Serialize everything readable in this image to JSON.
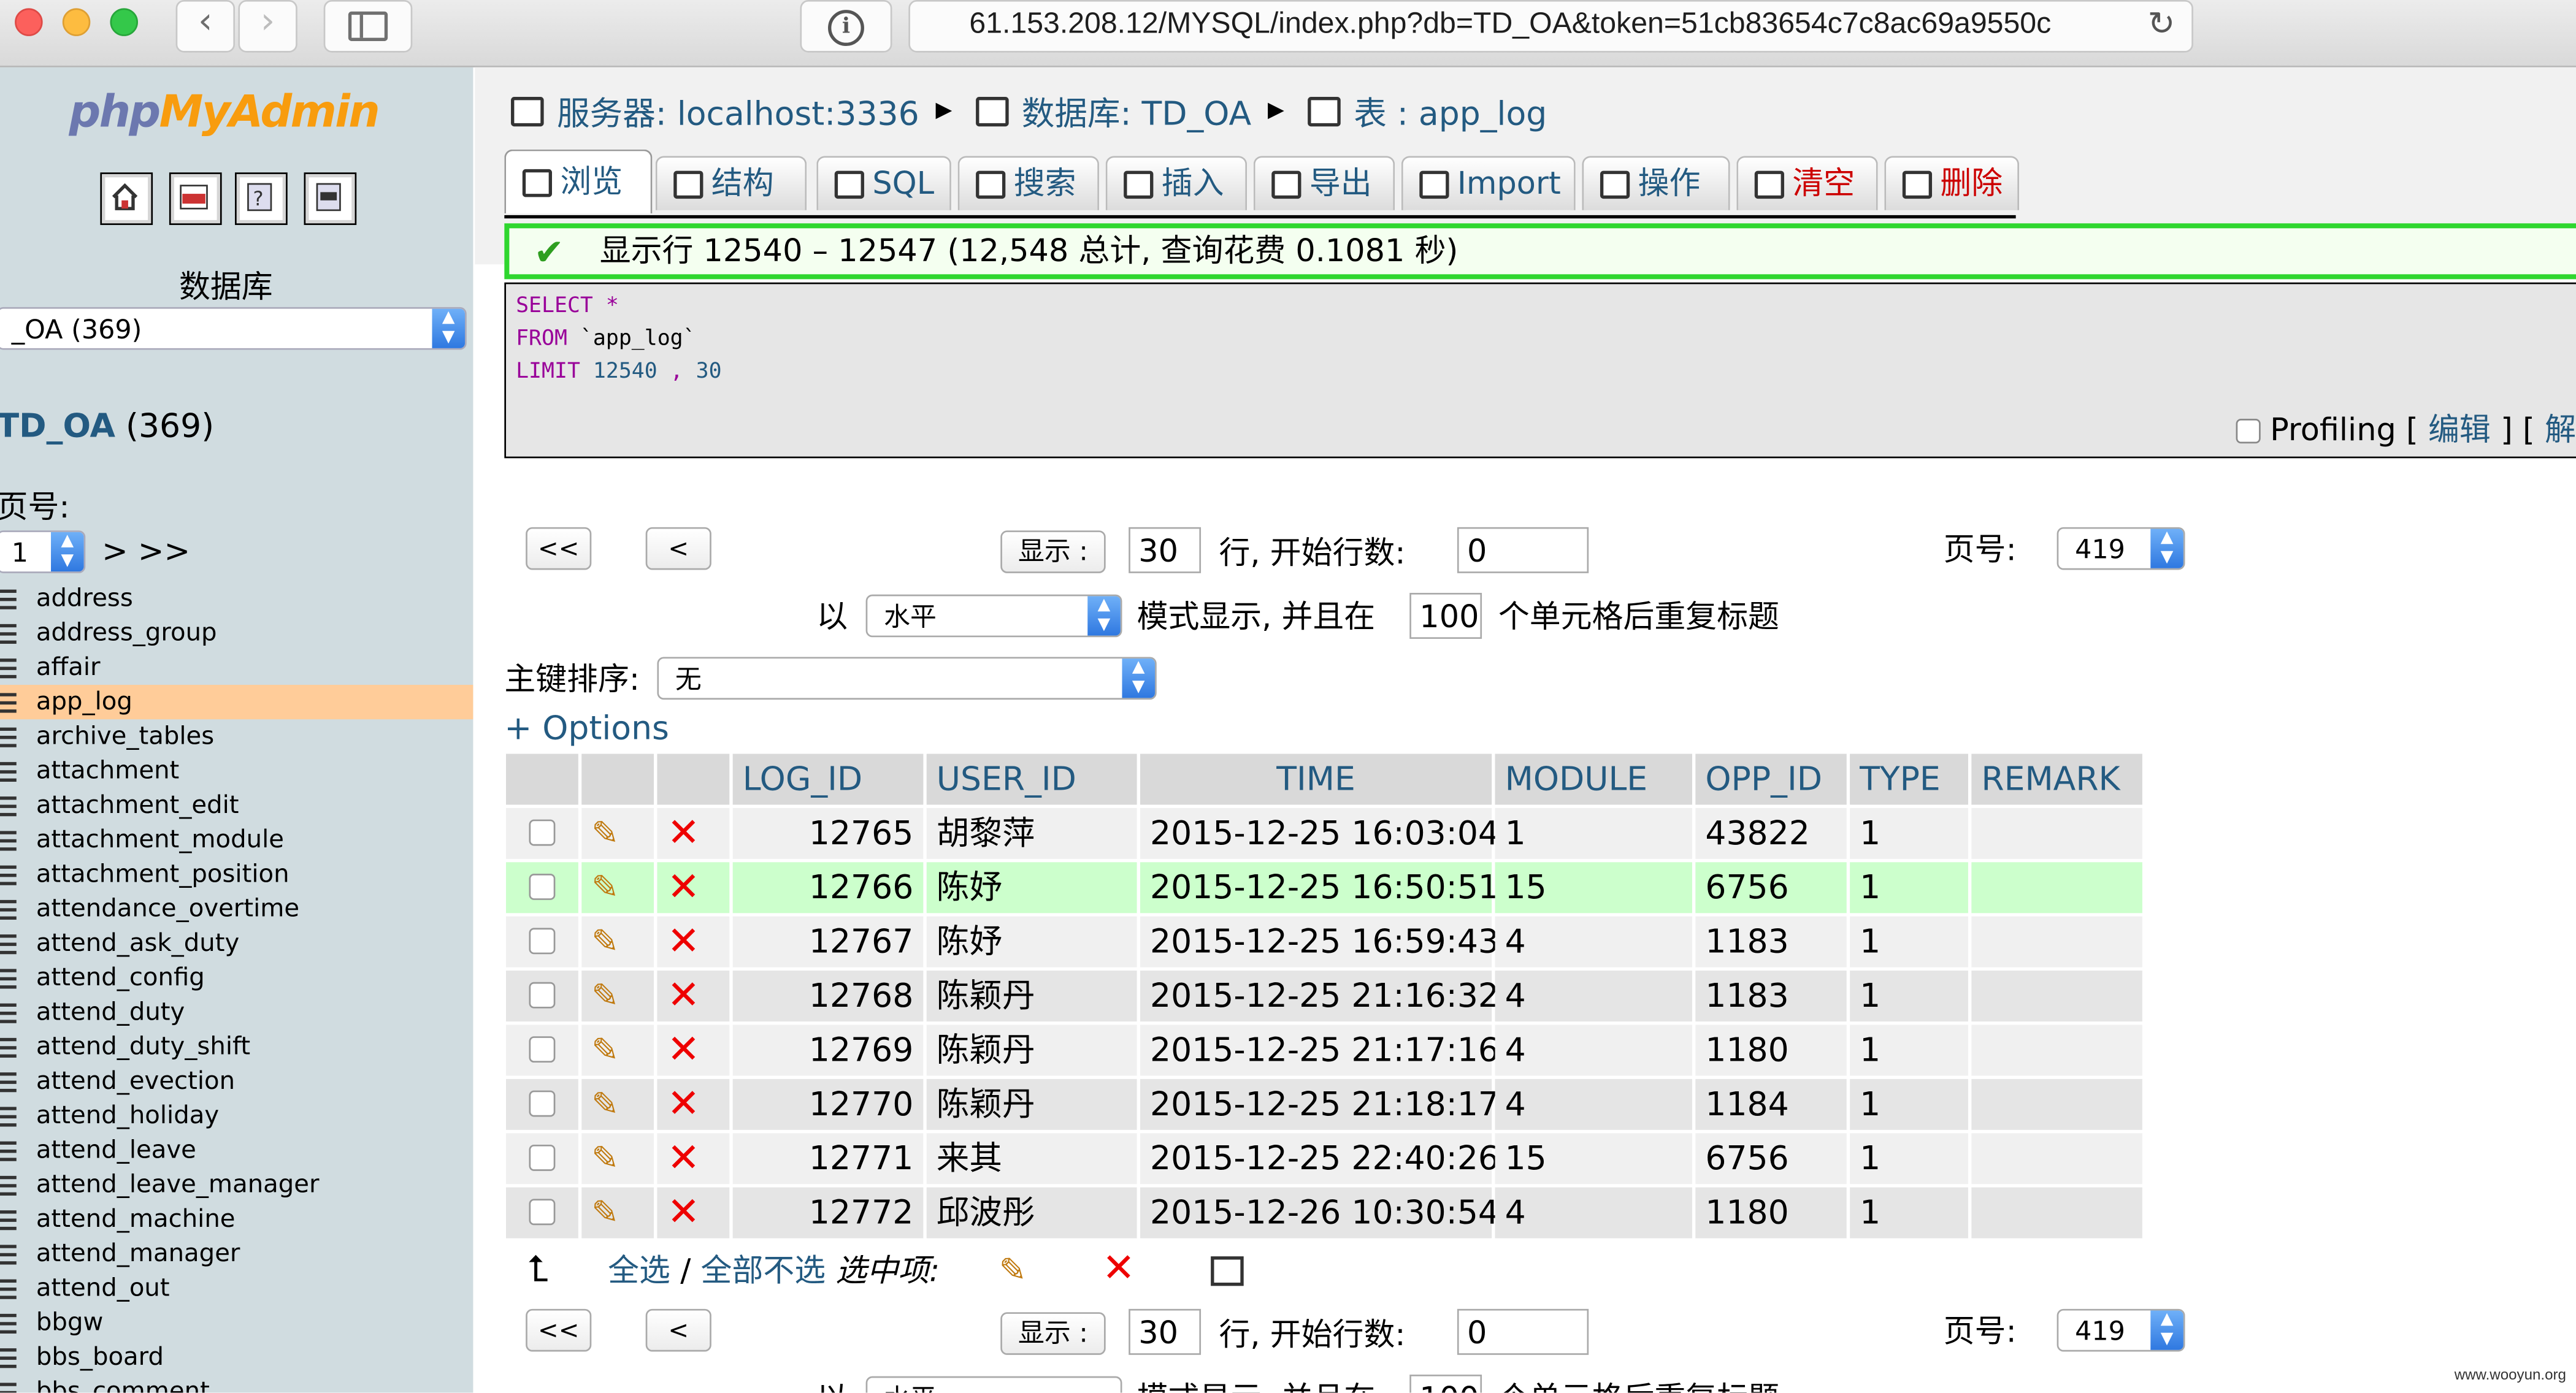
{
  "browser": {
    "url": "61.153.208.12/MYSQL/index.php?db=TD_OA&token=51cb83654c7c8ac69a9550c"
  },
  "left": {
    "logo_a": "php",
    "logo_b": "MyAdmin",
    "db_label": "数据库",
    "db_select": "_OA (369)",
    "db_title": "TD_OA",
    "db_count": "(369)",
    "page_label": "页号:",
    "page_value": "1",
    "page_next": "> >>",
    "tables": [
      "address",
      "address_group",
      "affair",
      "app_log",
      "archive_tables",
      "attachment",
      "attachment_edit",
      "attachment_module",
      "attachment_position",
      "attendance_overtime",
      "attend_ask_duty",
      "attend_config",
      "attend_duty",
      "attend_duty_shift",
      "attend_evection",
      "attend_holiday",
      "attend_leave",
      "attend_leave_manager",
      "attend_machine",
      "attend_manager",
      "attend_out",
      "bbgw",
      "bbs_board",
      "bbs_comment"
    ],
    "active_table": "app_log"
  },
  "breadcrumb": {
    "server": "服务器: localhost:3336",
    "database": "数据库: TD_OA",
    "table": "表 : app_log"
  },
  "tabs": [
    "浏览",
    "结构",
    "SQL",
    "搜索",
    "插入",
    "导出",
    "Import",
    "操作",
    "清空",
    "删除"
  ],
  "message": "显示行 12540 – 12547 (12,548 总计, 查询花费 0.1081 秒)",
  "sql": {
    "select": "SELECT",
    "star": "*",
    "from": "FROM",
    "table": "`app_log`",
    "limit": "LIMIT",
    "offset": "12540",
    "sep": ",",
    "count": "30"
  },
  "profiling": {
    "label": "Profiling",
    "edit": "编辑",
    "explain": "解"
  },
  "nav": {
    "first": "<<",
    "prev": "<",
    "show_label": "显示 :",
    "rows": "30",
    "start_label": "行, 开始行数:",
    "start": "0",
    "page_label": "页号:",
    "page": "419",
    "mode_prefix": "以",
    "mode": "水平",
    "mode_suffix": "模式显示, 并且在",
    "repeat": "100",
    "repeat_suffix": "个单元格后重复标题",
    "sort_label": "主键排序:",
    "sort_value": "无",
    "options": "+ Options"
  },
  "table": {
    "headers": [
      "LOG_ID",
      "USER_ID",
      "TIME",
      "MODULE",
      "OPP_ID",
      "TYPE",
      "REMARK"
    ],
    "rows": [
      [
        "12765",
        "胡黎萍",
        "2015-12-25 16:03:04",
        "1",
        "43822",
        "1",
        ""
      ],
      [
        "12766",
        "陈妤",
        "2015-12-25 16:50:51",
        "15",
        "6756",
        "1",
        ""
      ],
      [
        "12767",
        "陈妤",
        "2015-12-25 16:59:43",
        "4",
        "1183",
        "1",
        ""
      ],
      [
        "12768",
        "陈颖丹",
        "2015-12-25 21:16:32",
        "4",
        "1183",
        "1",
        ""
      ],
      [
        "12769",
        "陈颖丹",
        "2015-12-25 21:17:16",
        "4",
        "1180",
        "1",
        ""
      ],
      [
        "12770",
        "陈颖丹",
        "2015-12-25 21:18:17",
        "4",
        "1184",
        "1",
        ""
      ],
      [
        "12771",
        "来其",
        "2015-12-25 22:40:26",
        "15",
        "6756",
        "1",
        ""
      ],
      [
        "12772",
        "邱波彤",
        "2015-12-26 10:30:54",
        "4",
        "1180",
        "1",
        ""
      ]
    ]
  },
  "bulk": {
    "check_all": "全选",
    "sep": "/",
    "uncheck_all": "全部不选",
    "with_selected": "选中项:"
  },
  "watermark": "www.wooyun.org"
}
